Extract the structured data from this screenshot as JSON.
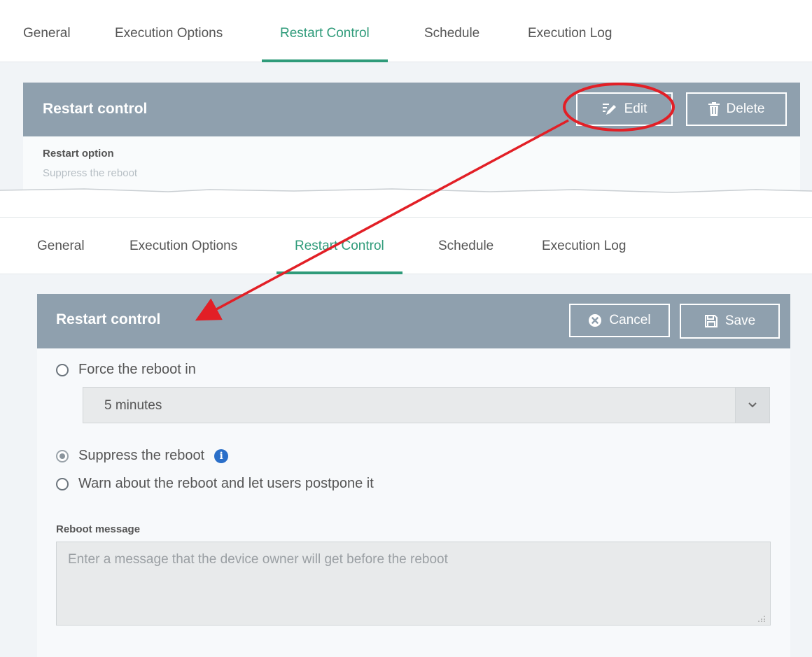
{
  "tabs": [
    "General",
    "Execution Options",
    "Restart Control",
    "Schedule",
    "Execution Log"
  ],
  "active_tab": "Restart Control",
  "view_panel": {
    "header_title": "Restart control",
    "edit_label": "Edit",
    "delete_label": "Delete",
    "field_label": "Restart option",
    "field_value": "Suppress the reboot"
  },
  "edit_panel": {
    "header_title": "Restart control",
    "cancel_label": "Cancel",
    "save_label": "Save",
    "options": [
      {
        "label": "Force the reboot in",
        "checked": false
      },
      {
        "label": "Suppress the reboot",
        "checked": true
      },
      {
        "label": "Warn about the reboot and let users postpone it",
        "checked": false
      }
    ],
    "reboot_delay_selected": "5 minutes",
    "reboot_message_label": "Reboot message",
    "reboot_message_placeholder": "Enter a message that the device owner will get before the reboot",
    "reboot_message_value": ""
  },
  "icons": {
    "edit": "pencil-icon",
    "delete": "trash-icon",
    "cancel": "close-circle-icon",
    "save": "save-icon",
    "dropdown": "chevron-down-icon",
    "info": "info-icon"
  },
  "colors": {
    "accent": "#2f9b7a",
    "header_bar": "#8fa0ae",
    "annotation": "#e21f26",
    "info": "#2a6fc9"
  }
}
